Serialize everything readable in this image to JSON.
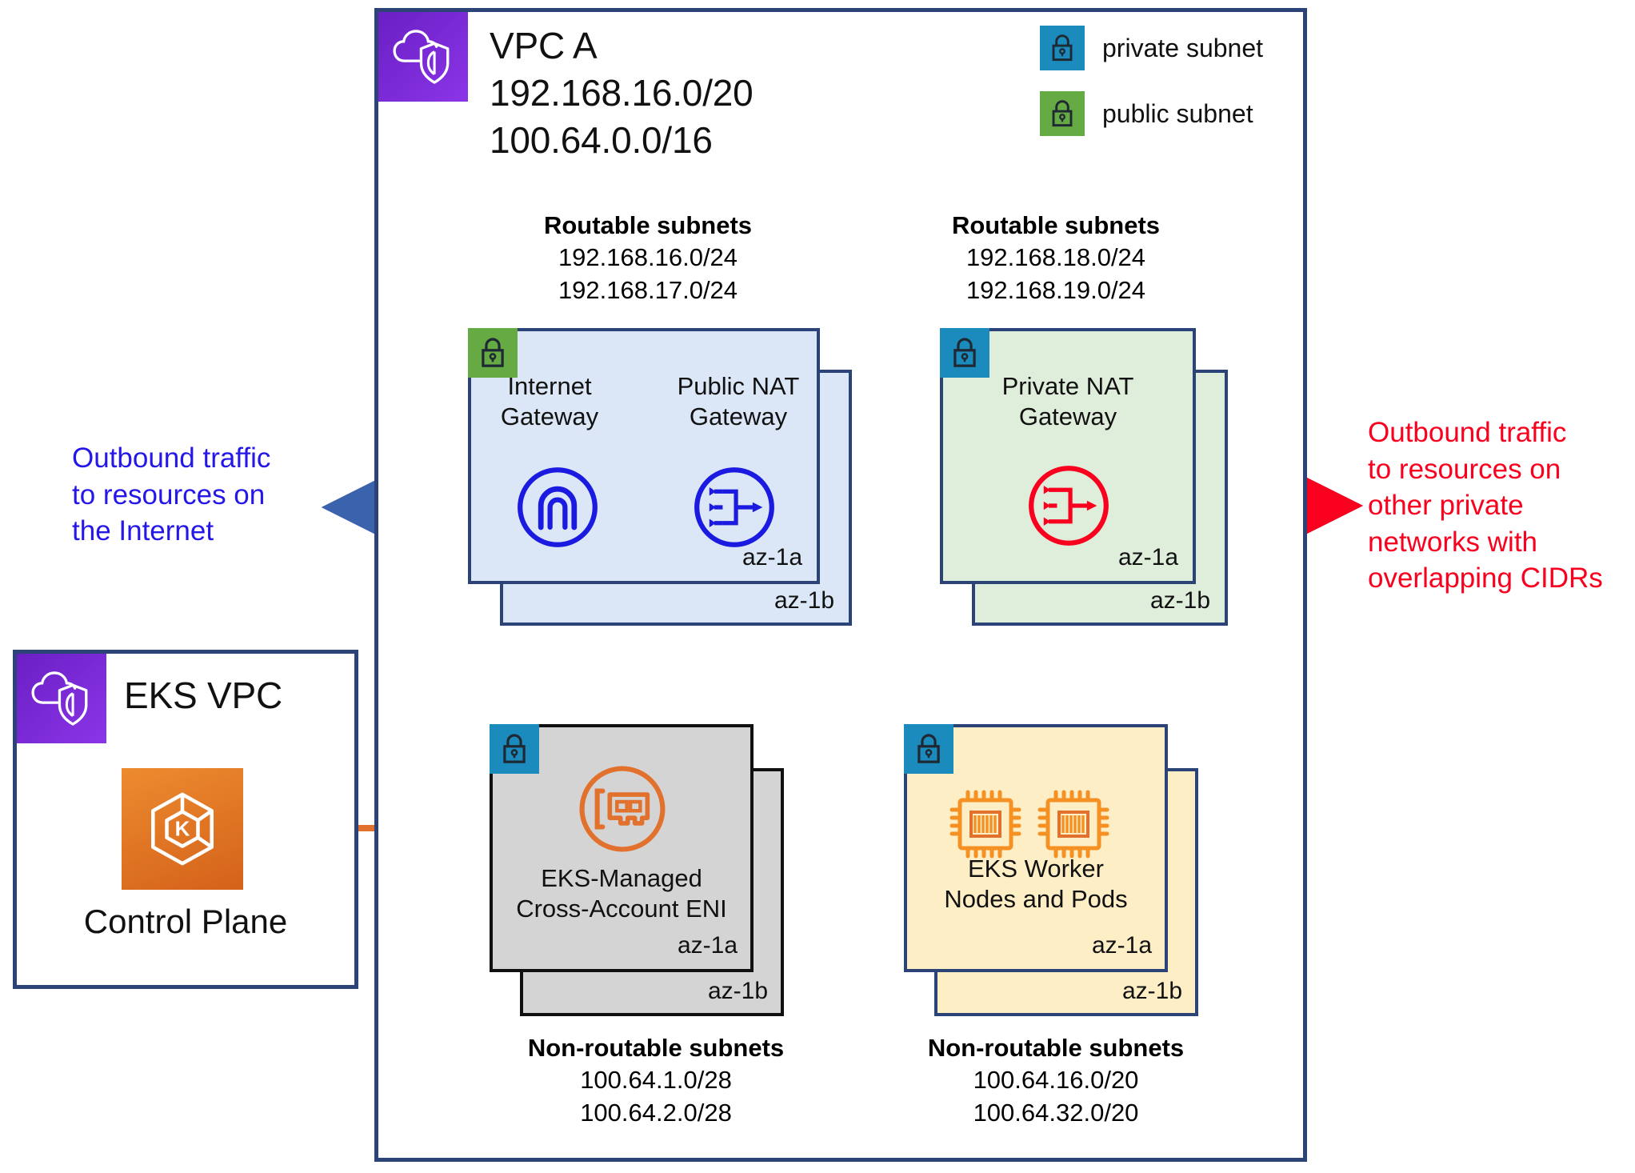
{
  "vpc_a": {
    "icon": "vpc-cloud-shield-icon",
    "title": "VPC A\n192.168.16.0/20\n100.64.0.0/16"
  },
  "eks_vpc": {
    "icon": "vpc-cloud-shield-icon",
    "title": "EKS VPC",
    "control_plane": {
      "icon": "eks-kubernetes-icon",
      "label": "Control Plane"
    }
  },
  "legend": {
    "items": [
      {
        "icon": "lock-icon",
        "label": "private subnet",
        "color": "#1b8bbd"
      },
      {
        "icon": "lock-icon",
        "label": "public subnet",
        "color": "#66aa44"
      }
    ]
  },
  "subnet_groups": {
    "public_routable": {
      "heading": "Routable subnets",
      "cidrs": [
        "192.168.16.0/24",
        "192.168.17.0/24"
      ]
    },
    "private_routable": {
      "heading": "Routable subnets",
      "cidrs": [
        "192.168.18.0/24",
        "192.168.19.0/24"
      ]
    },
    "eni_nonroutable": {
      "heading": "Non-routable subnets",
      "cidrs": [
        "100.64.1.0/28",
        "100.64.2.0/28"
      ]
    },
    "worker_nonroutable": {
      "heading": "Non-routable subnets",
      "cidrs": [
        "100.64.16.0/20",
        "100.64.32.0/20"
      ]
    }
  },
  "cards": {
    "public_subnet": {
      "badge": "lock-icon",
      "badge_color": "#66aa44",
      "fill": "#dbe7f6",
      "az_front": "az-1a",
      "az_back": "az-1b",
      "nodes": [
        {
          "icon": "internet-gateway-icon",
          "label": "Internet\nGateway"
        },
        {
          "icon": "nat-gateway-icon",
          "label": "Public NAT\nGateway"
        }
      ]
    },
    "private_nat_subnet": {
      "badge": "lock-icon",
      "badge_color": "#1b8bbd",
      "fill": "#dfeddb",
      "az_front": "az-1a",
      "az_back": "az-1b",
      "nodes": [
        {
          "icon": "nat-gateway-icon",
          "label": "Private NAT\nGateway"
        }
      ]
    },
    "eni_subnet": {
      "badge": "lock-icon",
      "badge_color": "#1b8bbd",
      "fill": "#d4d4d4",
      "az_front": "az-1a",
      "az_back": "az-1b",
      "nodes": [
        {
          "icon": "network-interface-icon",
          "label": "EKS-Managed\nCross-Account ENI"
        }
      ]
    },
    "worker_subnet": {
      "badge": "lock-icon",
      "badge_color": "#1b8bbd",
      "fill": "#fdeec6",
      "az_front": "az-1a",
      "az_back": "az-1b",
      "nodes": [
        {
          "icon": "cpu-chip-icon",
          "label": "EKS Worker\nNodes and Pods"
        },
        {
          "icon": "cpu-chip-icon",
          "label": ""
        }
      ]
    }
  },
  "annotations": {
    "internet_egress": "Outbound traffic\nto resources on\nthe Internet",
    "private_egress": "Outbound traffic\nto resources on\nother private\nnetworks with\noverlapping CIDRs"
  },
  "colors": {
    "vpc_border": "#2b4377",
    "steel_blue": "#3b63ad",
    "bright_blue": "#2417e8",
    "red": "#f8001e",
    "orange": "#e1712c",
    "aws_orange": "#ed8b2f",
    "private_badge": "#1b8bbd",
    "public_badge": "#66aa44"
  }
}
